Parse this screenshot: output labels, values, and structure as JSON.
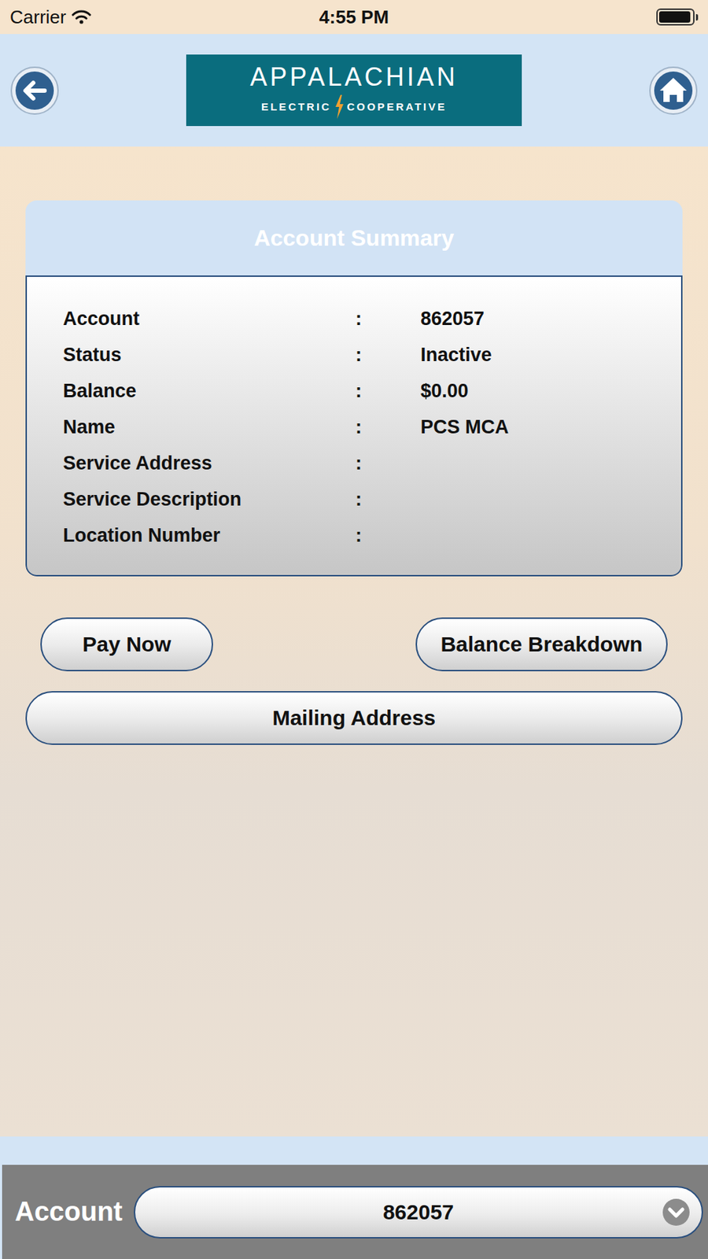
{
  "status_bar": {
    "carrier": "Carrier",
    "time": "4:55 PM",
    "battery_level": 0.95
  },
  "header": {
    "logo": {
      "title": "APPALACHIAN",
      "subtitle_left": "ELECTRIC",
      "subtitle_right": "COOPERATIVE"
    }
  },
  "account_summary": {
    "title": "Account Summary",
    "separator": ":",
    "rows": [
      {
        "label": "Account",
        "value": "862057"
      },
      {
        "label": "Status",
        "value": "Inactive"
      },
      {
        "label": "Balance",
        "value": "$0.00"
      },
      {
        "label": "Name",
        "value": "PCS MCA"
      },
      {
        "label": "Service Address",
        "value": ""
      },
      {
        "label": "Service Description",
        "value": ""
      },
      {
        "label": "Location Number",
        "value": ""
      }
    ]
  },
  "buttons": [
    "Pay Now",
    "Balance Breakdown",
    "Mailing Address"
  ],
  "account_selector": {
    "label": "Account",
    "value": "862057"
  }
}
